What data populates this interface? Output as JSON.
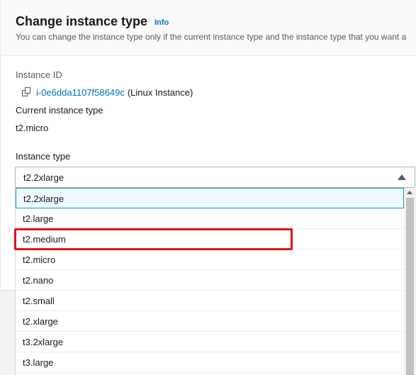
{
  "header": {
    "title": "Change instance type",
    "info_link": "Info",
    "description": "You can change the instance type only if the current instance type and the instance type that you want a"
  },
  "instance": {
    "id_label": "Instance ID",
    "id_value": "i-0e6dda1107f58649c",
    "id_suffix": "(Linux Instance)",
    "current_label": "Current instance type",
    "current_value": "t2.micro"
  },
  "instance_type": {
    "label": "Instance type",
    "selected": "t2.2xlarge",
    "options": [
      "t2.2xlarge",
      "t2.large",
      "t2.medium",
      "t2.micro",
      "t2.nano",
      "t2.small",
      "t2.xlarge",
      "t3.2xlarge",
      "t3.large"
    ]
  },
  "colors": {
    "link": "#0073bb",
    "selected_border": "#00a1c9",
    "highlight": "#e5111a"
  }
}
